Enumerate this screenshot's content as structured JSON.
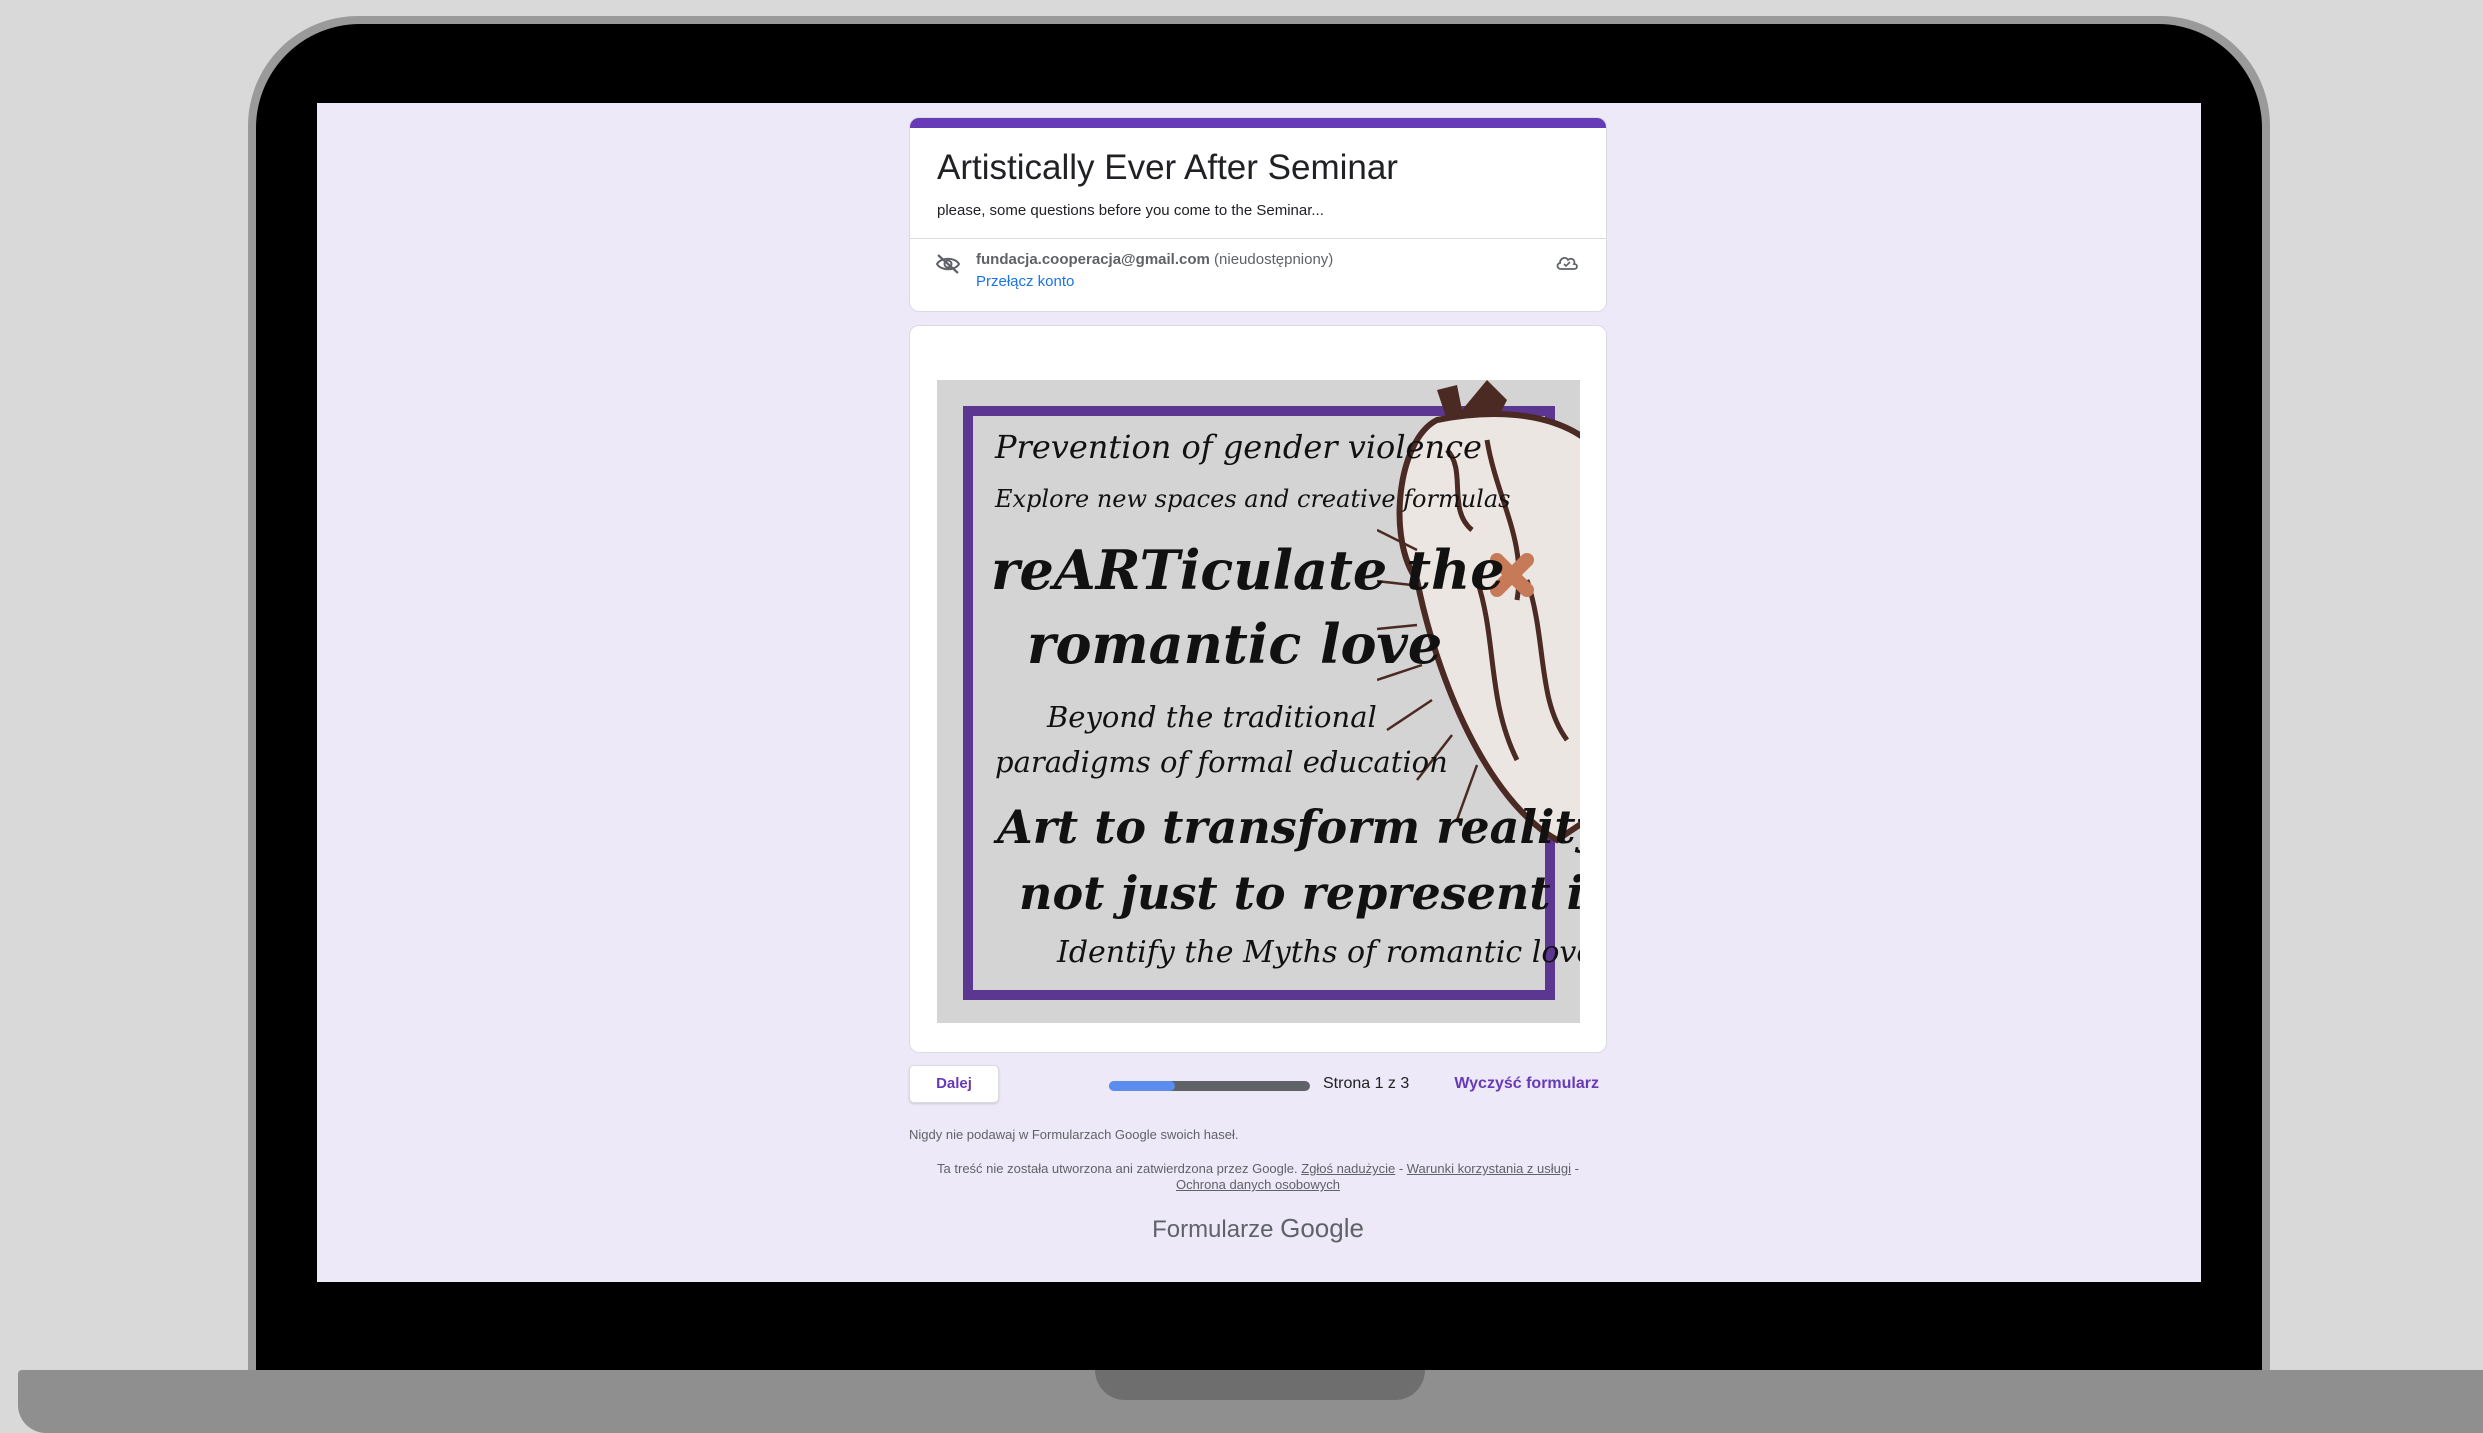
{
  "form": {
    "title": "Artistically Ever After Seminar",
    "description": "please, some questions before you come to the Seminar...",
    "accent_color": "#673ab7"
  },
  "account": {
    "email": "fundacja.cooperacja@gmail.com",
    "status": "(nieudostępniony)",
    "switch_label": "Przełącz konto"
  },
  "poster": {
    "lines": [
      "Prevention of gender violence",
      "Explore new spaces and creative formulas",
      "reARTiculate the",
      "romantic love",
      "Beyond the traditional",
      "paradigms of formal education",
      "Art to transform reality,",
      "not just to represent it",
      "Identify the Myths of romantic love"
    ],
    "frame_color": "#5c3791"
  },
  "navigation": {
    "next_label": "Dalej",
    "page_indicator": "Strona 1 z 3",
    "progress_fraction": 0.33,
    "clear_label": "Wyczyść formularz"
  },
  "footer": {
    "note": "Nigdy nie podawaj w Formularzach Google swoich haseł.",
    "legal_prefix": "Ta treść nie została utworzona ani zatwierdzona przez Google.",
    "report_link": "Zgłoś nadużycie",
    "terms_link": "Warunki korzystania z usługi",
    "privacy_link": "Ochrona danych osobowych",
    "brand_word": "Formularze",
    "brand_google": "Google"
  }
}
